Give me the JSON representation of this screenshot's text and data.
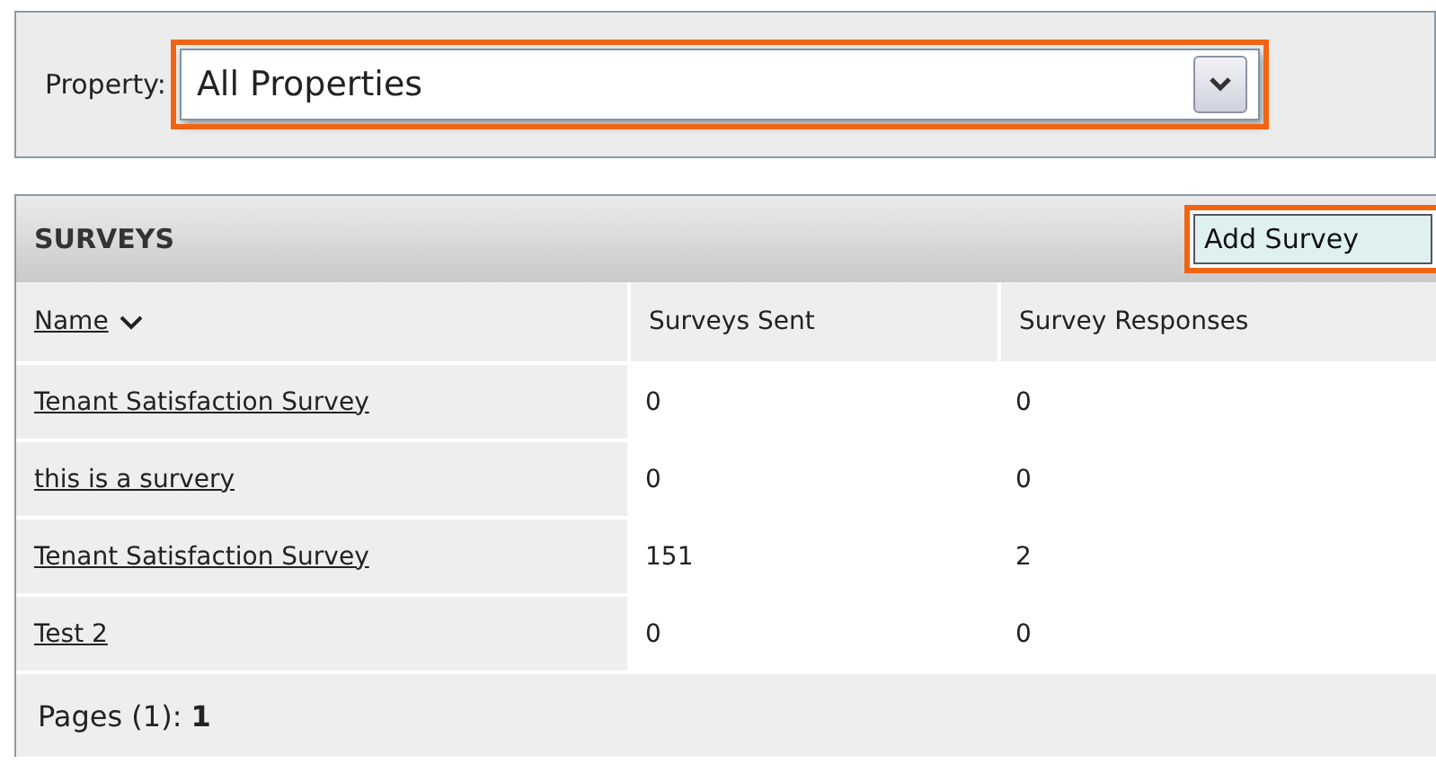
{
  "filter": {
    "label": "Property:",
    "value": "All Properties",
    "highlighted": true
  },
  "surveys": {
    "title": "SURVEYS",
    "add_button": {
      "label": "Add Survey",
      "highlighted": true
    },
    "columns": [
      {
        "label": "Name",
        "sorted": true
      },
      {
        "label": "Surveys Sent",
        "sorted": false
      },
      {
        "label": "Survey Responses",
        "sorted": false
      }
    ],
    "rows": [
      {
        "name": "Tenant Satisfaction Survey",
        "sent": "0",
        "responses": "0"
      },
      {
        "name": "this is a survery",
        "sent": "0",
        "responses": "0"
      },
      {
        "name": "Tenant Satisfaction Survey",
        "sent": "151",
        "responses": "2"
      },
      {
        "name": "Test 2",
        "sent": "0",
        "responses": "0"
      }
    ],
    "pager": "Pages (1): **1**"
  }
}
